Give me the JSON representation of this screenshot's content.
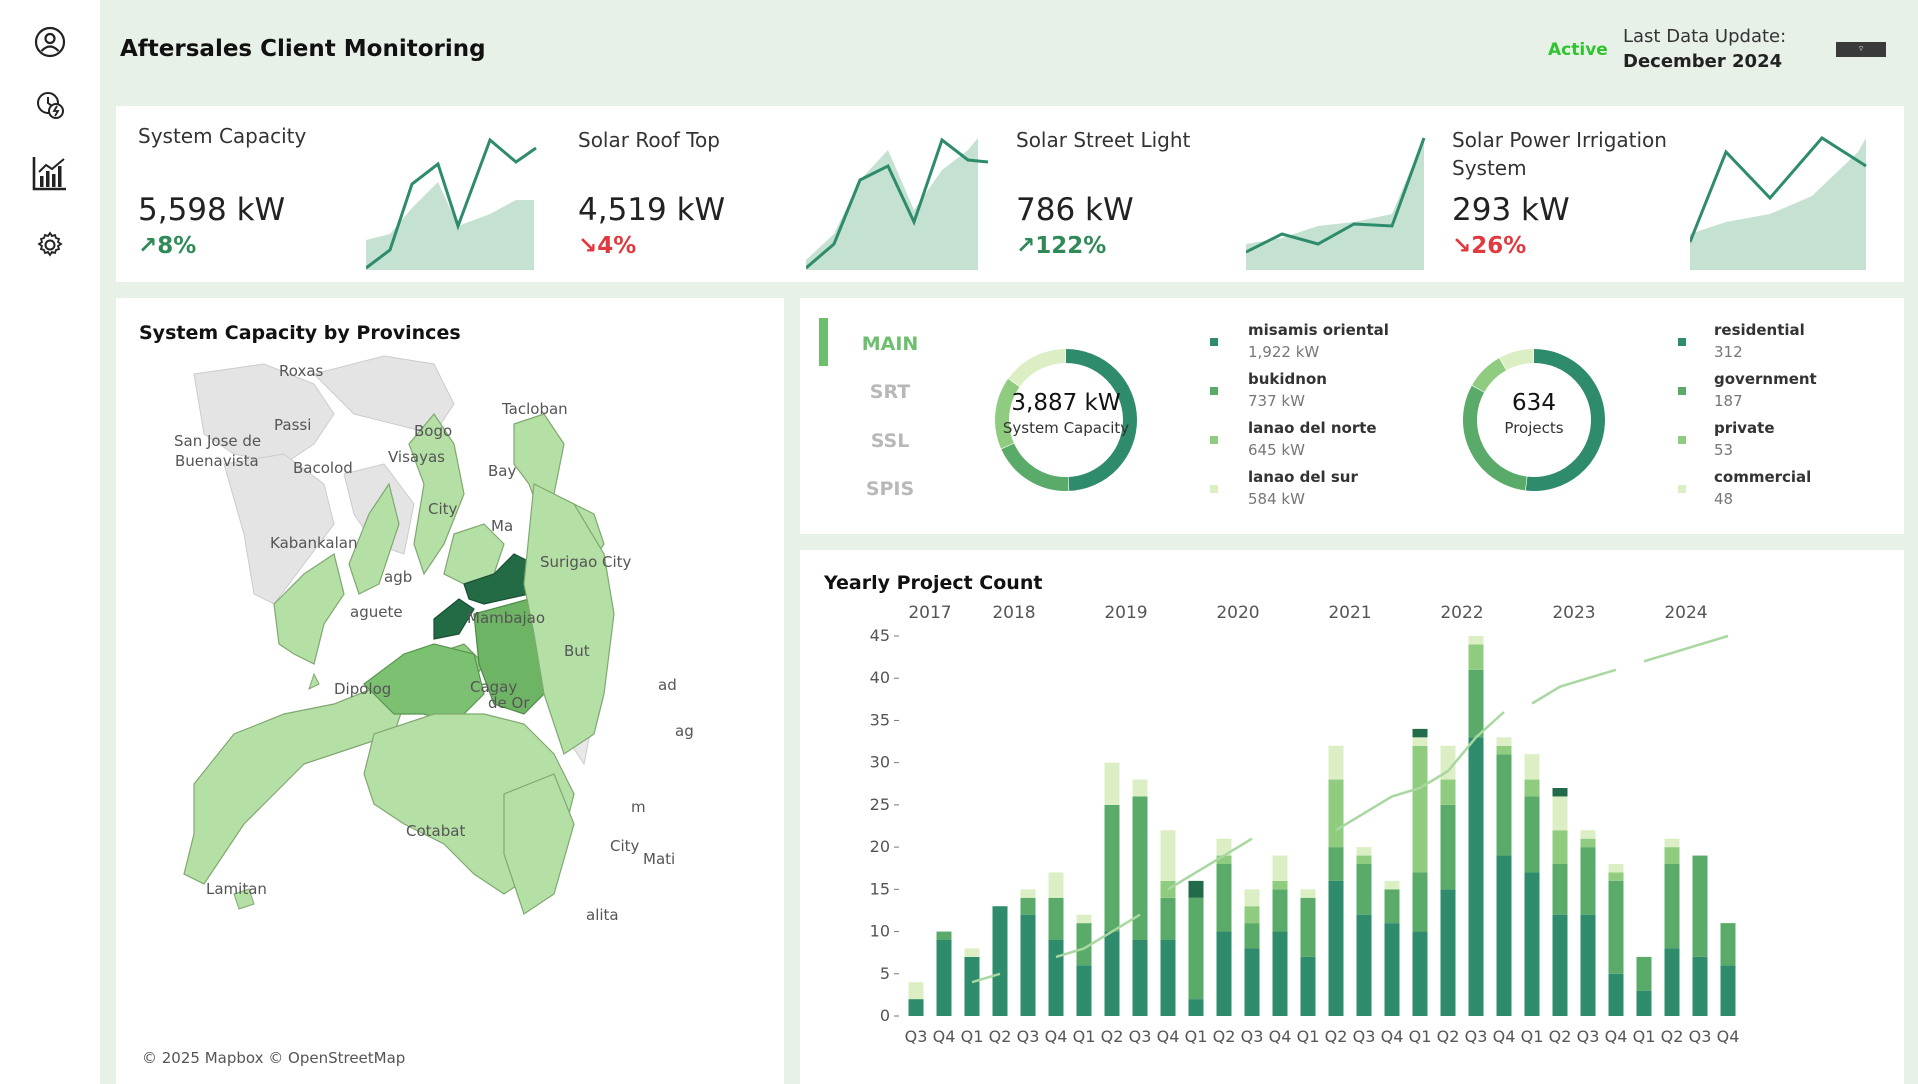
{
  "header": {
    "title": "Aftersales Client Monitoring",
    "status": "Active",
    "last_update_label": "Last Data Update:",
    "last_update_value": "December 2024",
    "menu_glyph": "▿"
  },
  "sidebar": {
    "items": [
      {
        "icon": "user-icon"
      },
      {
        "icon": "solar-energy-icon"
      },
      {
        "icon": "analytics-chart-icon"
      },
      {
        "icon": "gear-icon"
      }
    ]
  },
  "kpis": [
    {
      "title": "System Capacity",
      "value": "5,598 kW",
      "change": "8%",
      "direction": "up",
      "arrow": "↗"
    },
    {
      "title": "Solar Roof Top",
      "value": "4,519 kW",
      "change": "4%",
      "direction": "down",
      "arrow": "↘"
    },
    {
      "title": "Solar Street Light",
      "value": "786 kW",
      "change": "122%",
      "direction": "up",
      "arrow": "↗"
    },
    {
      "title": "Solar Power Irrigation System",
      "value": "293 kW",
      "change": "26%",
      "direction": "down",
      "arrow": "↘"
    }
  ],
  "map": {
    "title": "System Capacity by Provinces",
    "credit": "© 2025 Mapbox © OpenStreetMap",
    "labels": [
      "Roxas",
      "San Jose de",
      "Buenavista",
      "Passi",
      "Bacolod",
      "Kabankalan",
      "Bogo",
      "Tacloban",
      "Visayas",
      "Bay",
      "City",
      "Ma",
      "Surigao City",
      "Mambajao",
      "aguete",
      "Dipolog",
      "Cagay",
      "de Or",
      "But",
      "Cotabat",
      "Lamitan",
      "Mati",
      "City",
      "alita",
      "m",
      "ad",
      "ag",
      "agb"
    ]
  },
  "summary": {
    "tabs": [
      "MAIN",
      "SRT",
      "SSL",
      "SPIS"
    ],
    "active_tab": "MAIN",
    "capacity_total": "3,887 kW",
    "capacity_label": "System Capacity",
    "projects_total": "634",
    "projects_label": "Projects",
    "provinces": [
      {
        "name": "misamis oriental",
        "value": "1,922 kW",
        "num": 1922,
        "color": "#2e8b6b"
      },
      {
        "name": "bukidnon",
        "value": "737 kW",
        "num": 737,
        "color": "#5aab6a"
      },
      {
        "name": "lanao del norte",
        "value": "645 kW",
        "num": 645,
        "color": "#8fcc80"
      },
      {
        "name": "lanao del sur",
        "value": "584 kW",
        "num": 584,
        "color": "#dcefc4"
      }
    ],
    "sectors": [
      {
        "name": "residential",
        "value": "312",
        "num": 312,
        "color": "#2e8b6b"
      },
      {
        "name": "government",
        "value": "187",
        "num": 187,
        "color": "#5aab6a"
      },
      {
        "name": "private",
        "value": "53",
        "num": 53,
        "color": "#8fcc80"
      },
      {
        "name": "commercial",
        "value": "48",
        "num": 48,
        "color": "#dcefc4"
      }
    ]
  },
  "chart_data": {
    "type": "bar",
    "title": "Yearly Project Count",
    "years": [
      "2017",
      "2018",
      "2019",
      "2020",
      "2021",
      "2022",
      "2023",
      "2024"
    ],
    "categories": [
      "Q3",
      "Q4",
      "Q1",
      "Q2",
      "Q3",
      "Q4",
      "Q1",
      "Q2",
      "Q3",
      "Q4",
      "Q1",
      "Q2",
      "Q3",
      "Q4",
      "Q1",
      "Q2",
      "Q3",
      "Q4",
      "Q1",
      "Q2",
      "Q3",
      "Q4",
      "Q1",
      "Q2",
      "Q3",
      "Q4",
      "Q1",
      "Q2",
      "Q3",
      "Q4"
    ],
    "year_of_category": [
      "2017",
      "2017",
      "2018",
      "2018",
      "2018",
      "2018",
      "2019",
      "2019",
      "2019",
      "2019",
      "2020",
      "2020",
      "2020",
      "2020",
      "2021",
      "2021",
      "2021",
      "2021",
      "2022",
      "2022",
      "2022",
      "2022",
      "2023",
      "2023",
      "2023",
      "2023",
      "2024",
      "2024",
      "2024",
      "2024"
    ],
    "ylim": [
      0,
      45
    ],
    "yticks": [
      0,
      5,
      10,
      15,
      20,
      25,
      30,
      35,
      40,
      45
    ],
    "series": [
      {
        "color": "#2e8b6b",
        "values": [
          2,
          9,
          7,
          13,
          12,
          9,
          6,
          10,
          9,
          9,
          2,
          10,
          8,
          10,
          7,
          16,
          12,
          11,
          10,
          15,
          33,
          19,
          17,
          12,
          12,
          5,
          3,
          8,
          7,
          6
        ]
      },
      {
        "color": "#5aab6a",
        "values": [
          0,
          1,
          0,
          0,
          2,
          5,
          5,
          15,
          17,
          5,
          12,
          8,
          3,
          5,
          7,
          4,
          6,
          4,
          7,
          10,
          8,
          12,
          9,
          6,
          8,
          11,
          4,
          10,
          12,
          5
        ]
      },
      {
        "color": "#8fcc80",
        "values": [
          0,
          0,
          0,
          0,
          0,
          0,
          0,
          0,
          0,
          2,
          0,
          1,
          2,
          1,
          0,
          8,
          1,
          0,
          15,
          3,
          3,
          1,
          2,
          4,
          1,
          1,
          0,
          2,
          0,
          0
        ]
      },
      {
        "color": "#dcefc4",
        "values": [
          2,
          0,
          1,
          0,
          1,
          3,
          1,
          5,
          2,
          6,
          0,
          2,
          2,
          3,
          1,
          4,
          1,
          1,
          1,
          4,
          1,
          1,
          3,
          4,
          1,
          1,
          0,
          1,
          0,
          0
        ]
      },
      {
        "color": "#226b4a",
        "values": [
          0,
          0,
          0,
          0,
          0,
          0,
          0,
          0,
          0,
          0,
          2,
          0,
          0,
          0,
          0,
          0,
          0,
          0,
          1,
          0,
          0,
          0,
          0,
          1,
          0,
          0,
          0,
          0,
          0,
          0
        ]
      }
    ],
    "trend_segments": [
      [
        2,
        3
      ],
      [
        5,
        8
      ],
      [
        9,
        12
      ],
      [
        15,
        18
      ],
      [
        18,
        21
      ],
      [
        22,
        25
      ],
      [
        26,
        29
      ]
    ],
    "trend_values": [
      2,
      3,
      4,
      5,
      6,
      7,
      8,
      10,
      12,
      15,
      17,
      19,
      21,
      23,
      19,
      22,
      24,
      26,
      27,
      29,
      33,
      36,
      37,
      39,
      40,
      41,
      42,
      43,
      44,
      45
    ]
  }
}
